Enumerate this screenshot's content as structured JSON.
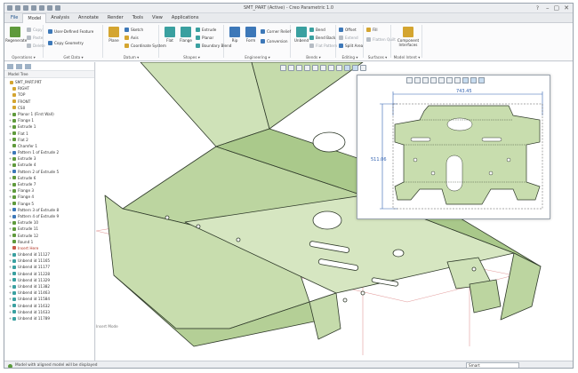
{
  "window": {
    "title": "SMT_PART (Active) - Creo Parametric 1.0",
    "help_icon": "?"
  },
  "tabs": [
    "File",
    "Model",
    "Analysis",
    "Annotate",
    "Render",
    "Tools",
    "View",
    "Applications"
  ],
  "active_tab": "Model",
  "ribbon": {
    "operations": {
      "regenerate": "Regenerate",
      "copy": "Copy",
      "paste": "Paste",
      "delete": "Delete",
      "label": "Operations ▾"
    },
    "get_data": {
      "udf": "User-Defined Feature",
      "copy_geometry": "Copy Geometry",
      "label": "Get Data ▾"
    },
    "datum": {
      "plane": "Plane",
      "sketch": "Sketch",
      "axis": "Axis",
      "csys": "Coordinate System",
      "label": "Datum ▾"
    },
    "shapes": {
      "flat": "Flat",
      "flange": "Flange",
      "extrude": "Extrude",
      "planar": "Planar",
      "boundary_blend": "Boundary Blend",
      "label": "Shapes ▾"
    },
    "engineering": {
      "rip": "Rip",
      "form": "Form",
      "corner_relief": "Corner Relief",
      "conversion": "Conversion",
      "label": "Engineering ▾"
    },
    "bends": {
      "unbend": "Unbend",
      "bend": "Bend",
      "bend_back": "Bend Back",
      "flat_pattern": "Flat Pattern",
      "label": "Bends ▾"
    },
    "editing": {
      "offset": "Offset",
      "extend": "Extend",
      "split_area": "Split Area",
      "label": "Editing ▾"
    },
    "surfaces": {
      "fill": "Fill",
      "flatten_quilt": "Flatten Quilt",
      "label": "Surfaces ▾"
    },
    "model_intent": {
      "component_interfaces": "Component Interfaces",
      "label": "Model Intent ▾"
    }
  },
  "model_tree": {
    "header": "Model Tree",
    "items": [
      {
        "label": "SMT_PART.PRT",
        "icon": "part-icon",
        "expand": ""
      },
      {
        "label": "RIGHT",
        "icon": "datum-plane-icon",
        "expand": ""
      },
      {
        "label": "TOP",
        "icon": "datum-plane-icon",
        "expand": ""
      },
      {
        "label": "FRONT",
        "icon": "datum-plane-icon",
        "expand": ""
      },
      {
        "label": "CS0",
        "icon": "csys-icon",
        "expand": ""
      },
      {
        "label": "Planar 1 (First Wall)",
        "icon": "wall-icon",
        "expand": "+"
      },
      {
        "label": "Flange 1",
        "icon": "flange-icon",
        "expand": "+"
      },
      {
        "label": "Extrude 1",
        "icon": "extrude-icon",
        "expand": "+"
      },
      {
        "label": "Flat 1",
        "icon": "flat-icon",
        "expand": "+"
      },
      {
        "label": "Flat 2",
        "icon": "flat-icon",
        "expand": "+"
      },
      {
        "label": "Chamfer 1",
        "icon": "chamfer-icon",
        "expand": ""
      },
      {
        "label": "Pattern 1 of Extrude 2",
        "icon": "pattern-icon",
        "expand": "+"
      },
      {
        "label": "Extrude 3",
        "icon": "extrude-icon",
        "expand": "+"
      },
      {
        "label": "Extrude 4",
        "icon": "extrude-icon",
        "expand": "+"
      },
      {
        "label": "Pattern 2 of Extrude 5",
        "icon": "pattern-icon",
        "expand": "+"
      },
      {
        "label": "Extrude 6",
        "icon": "extrude-icon",
        "expand": "+"
      },
      {
        "label": "Extrude 7",
        "icon": "extrude-icon",
        "expand": "+"
      },
      {
        "label": "Flange 3",
        "icon": "flange-icon",
        "expand": "+"
      },
      {
        "label": "Flange 4",
        "icon": "flange-icon",
        "expand": "+"
      },
      {
        "label": "Flange 5",
        "icon": "flange-icon",
        "expand": "+"
      },
      {
        "label": "Pattern 3 of Extrude 8",
        "icon": "pattern-icon",
        "expand": "+"
      },
      {
        "label": "Pattern 4 of Extrude 9",
        "icon": "pattern-icon",
        "expand": "+"
      },
      {
        "label": "Extrude 10",
        "icon": "extrude-icon",
        "expand": "+"
      },
      {
        "label": "Extrude 11",
        "icon": "extrude-icon",
        "expand": "+"
      },
      {
        "label": "Extrude 12",
        "icon": "extrude-icon",
        "expand": "+"
      },
      {
        "label": "Round 1",
        "icon": "round-icon",
        "expand": ""
      },
      {
        "label": "Insert Here",
        "icon": "insert-icon",
        "expand": ""
      },
      {
        "label": "Unbend id 11127",
        "icon": "unbend-icon",
        "expand": "+"
      },
      {
        "label": "Unbend id 11165",
        "icon": "unbend-icon",
        "expand": "+"
      },
      {
        "label": "Unbend id 11177",
        "icon": "unbend-icon",
        "expand": "+"
      },
      {
        "label": "Unbend id 11228",
        "icon": "unbend-icon",
        "expand": "+"
      },
      {
        "label": "Unbend id 11329",
        "icon": "unbend-icon",
        "expand": "+"
      },
      {
        "label": "Unbend id 11382",
        "icon": "unbend-icon",
        "expand": "+"
      },
      {
        "label": "Unbend id 11463",
        "icon": "unbend-icon",
        "expand": "+"
      },
      {
        "label": "Unbend id 11584",
        "icon": "unbend-icon",
        "expand": "+"
      },
      {
        "label": "Unbend id 11632",
        "icon": "unbend-icon",
        "expand": "+"
      },
      {
        "label": "Unbend id 11633",
        "icon": "unbend-icon",
        "expand": "+"
      },
      {
        "label": "Unbend id 11789",
        "icon": "unbend-icon",
        "expand": "+"
      }
    ]
  },
  "viewport": {
    "view_label": "Insert Mode"
  },
  "inset": {
    "width_dim": "743.45",
    "height_dim": "511.06"
  },
  "status": {
    "message": "Model with aligned model will be displayed",
    "filter": "Smart"
  },
  "colors": {
    "part_face": "#bdd6a3",
    "part_edge": "#2f3a2a",
    "dimension": "#3060b0"
  }
}
